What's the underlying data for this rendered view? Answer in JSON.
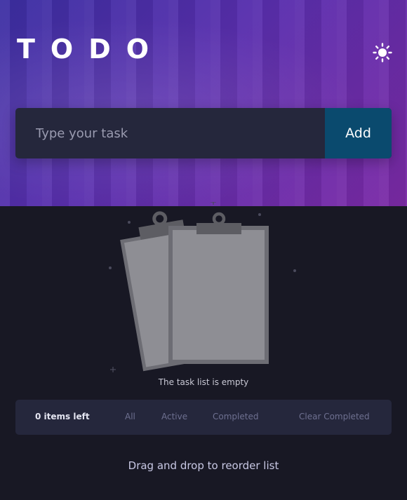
{
  "header": {
    "title": "TODO",
    "theme_toggle_icon": "sun-icon"
  },
  "composer": {
    "placeholder": "Type your task",
    "value": "",
    "add_label": "Add"
  },
  "empty_state": {
    "icon": "clipboard-illustration",
    "message": "The task list is empty"
  },
  "footer": {
    "items_left": "0 items left",
    "filters": [
      "All",
      "Active",
      "Completed"
    ],
    "clear_label": "Clear Completed"
  },
  "hint": "Drag and drop to reorder list",
  "colors": {
    "background": "#181824",
    "card": "#25273c",
    "add_button": "#0a4a6e",
    "accent_gradient_start": "#3c2fa3",
    "accent_gradient_end": "#7c2aa6"
  }
}
